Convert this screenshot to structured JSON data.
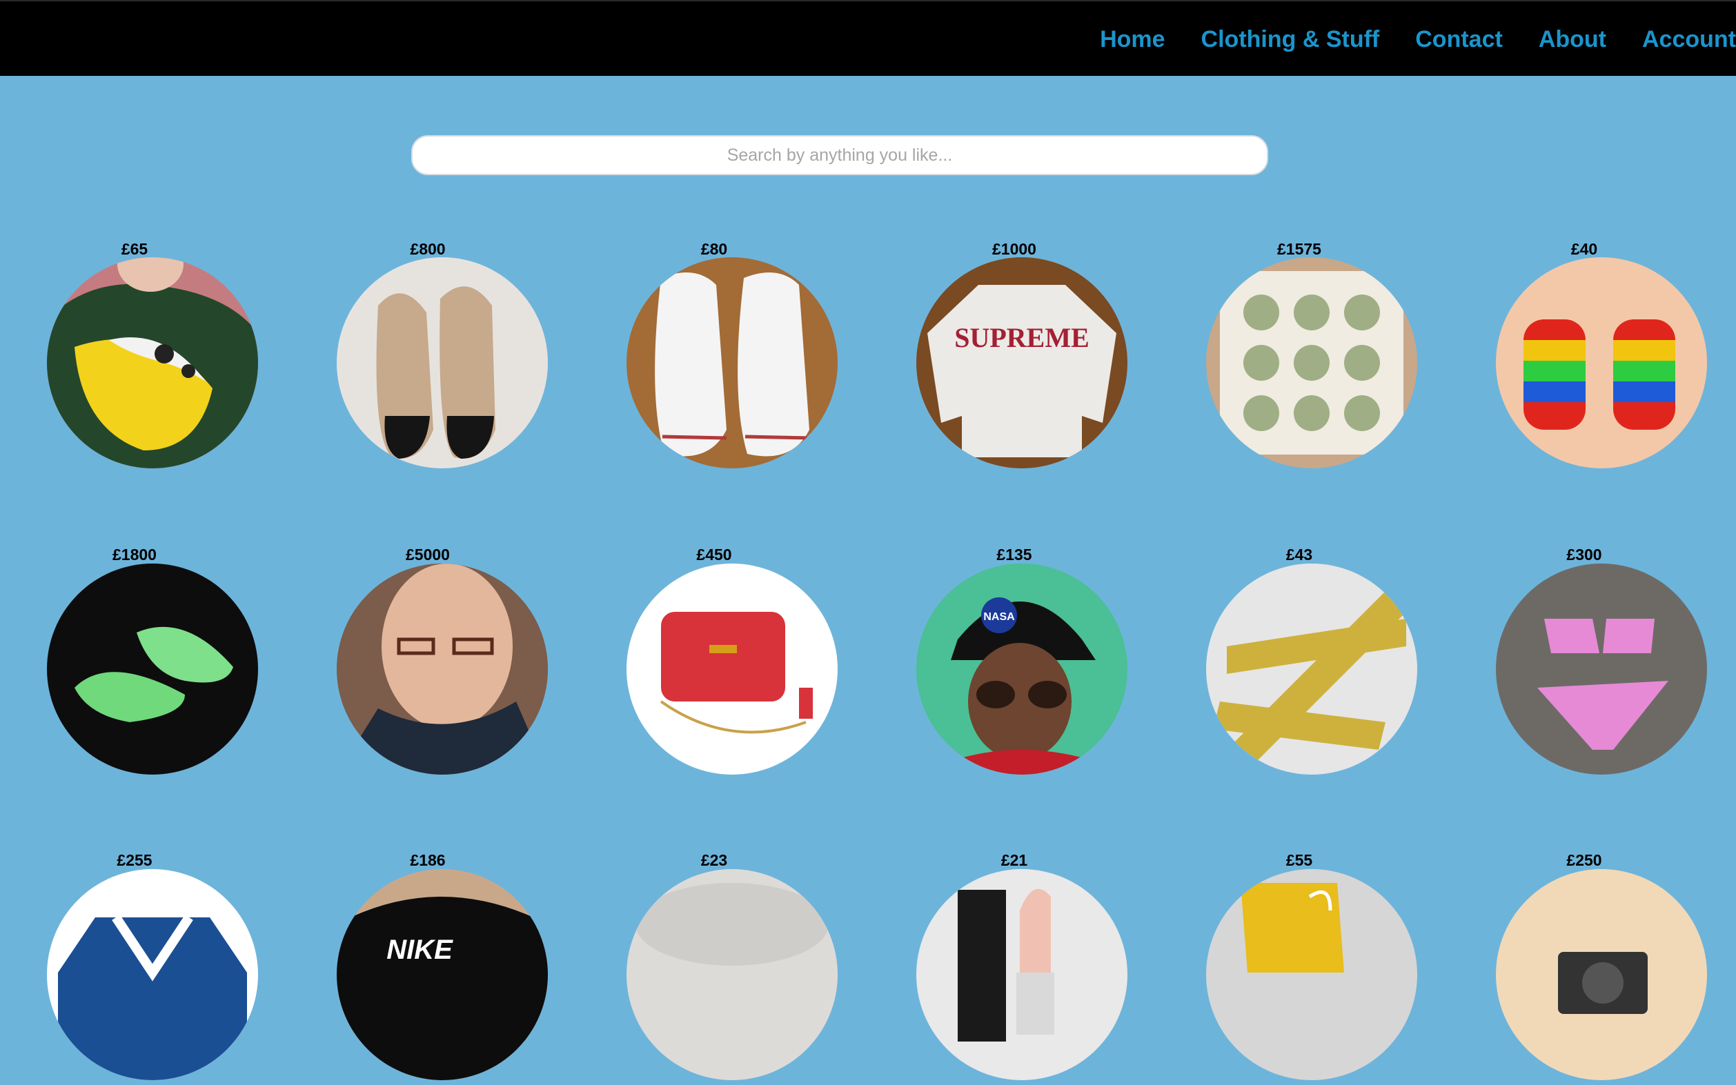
{
  "nav": {
    "links": [
      "Home",
      "Clothing & Stuff",
      "Contact",
      "About",
      "Account"
    ]
  },
  "search": {
    "placeholder": "Search by anything you like...",
    "value": ""
  },
  "colors": {
    "background": "#6db4db",
    "navbar": "#000000",
    "nav_link": "#1a95cc"
  },
  "products": [
    {
      "price": "£65",
      "image": "yellow-fur-bumbag"
    },
    {
      "price": "£800",
      "image": "chanel-espadrilles"
    },
    {
      "price": "£80",
      "image": "white-converse-hi-tops"
    },
    {
      "price": "£1000",
      "image": "supreme-knit-sweater",
      "image_text": "SUPREME"
    },
    {
      "price": "£1575",
      "image": "patterned-silk-scarf"
    },
    {
      "price": "£40",
      "image": "rainbow-knit-gloves"
    },
    {
      "price": "£1800",
      "image": "green-adidas-trainers"
    },
    {
      "price": "£5000",
      "image": "man-with-glasses-portrait"
    },
    {
      "price": "£450",
      "image": "red-quilted-bag"
    },
    {
      "price": "£135",
      "image": "nasa-cap-sunglasses-portrait",
      "image_text": "NASA"
    },
    {
      "price": "£43",
      "image": "off-white-yellow-belt"
    },
    {
      "price": "£300",
      "image": "pink-ruffle-bikini"
    },
    {
      "price": "£255",
      "image": "blue-track-jacket"
    },
    {
      "price": "£186",
      "image": "black-nike-cap",
      "image_text": "NIKE"
    },
    {
      "price": "£23",
      "image": "grey-item"
    },
    {
      "price": "£21",
      "image": "lipstick"
    },
    {
      "price": "£55",
      "image": "yellow-socks"
    },
    {
      "price": "£250",
      "image": "camera"
    }
  ]
}
